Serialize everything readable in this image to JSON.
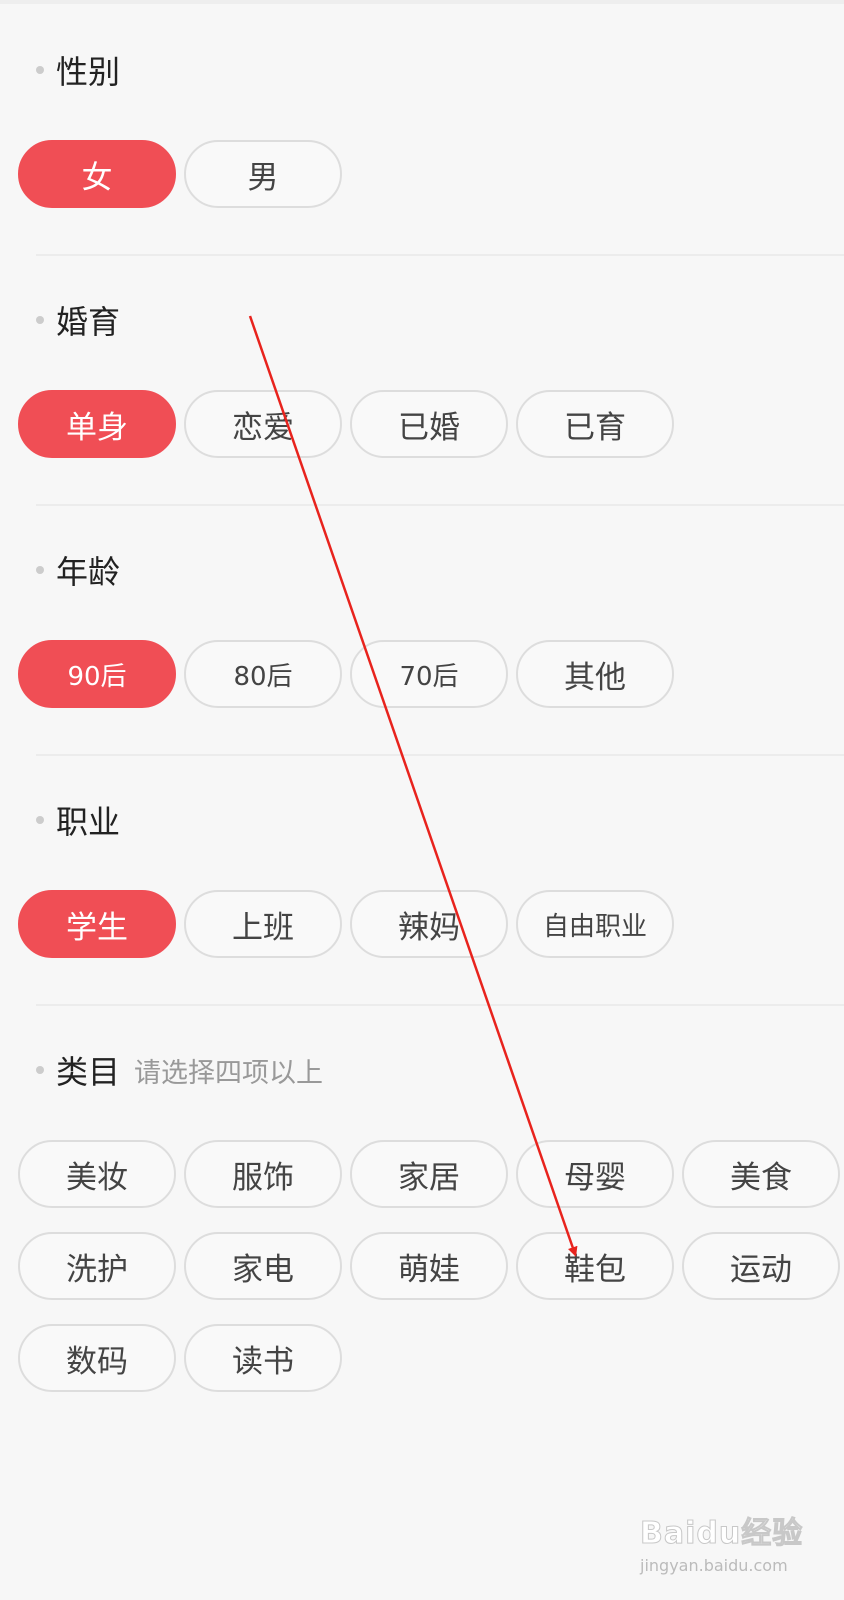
{
  "sections": {
    "gender": {
      "title": "性别",
      "options": [
        "女",
        "男"
      ],
      "selected": "女"
    },
    "marital": {
      "title": "婚育",
      "options": [
        "单身",
        "恋爱",
        "已婚",
        "已育"
      ],
      "selected": "单身"
    },
    "age": {
      "title": "年龄",
      "options": [
        "90后",
        "80后",
        "70后",
        "其他"
      ],
      "selected": "90后"
    },
    "occupation": {
      "title": "职业",
      "options": [
        "学生",
        "上班",
        "辣妈",
        "自由职业"
      ],
      "selected": "学生"
    },
    "category": {
      "title": "类目",
      "hint": "请选择四项以上",
      "options": [
        "美妆",
        "服饰",
        "家居",
        "母婴",
        "美食",
        "洗护",
        "家电",
        "萌娃",
        "鞋包",
        "运动",
        "数码",
        "读书"
      ]
    }
  },
  "colors": {
    "selected": "#f04e55",
    "annotation_arrow": "#e8231d"
  },
  "watermark": {
    "brand": "Baidu经验",
    "url": "jingyan.baidu.com"
  }
}
